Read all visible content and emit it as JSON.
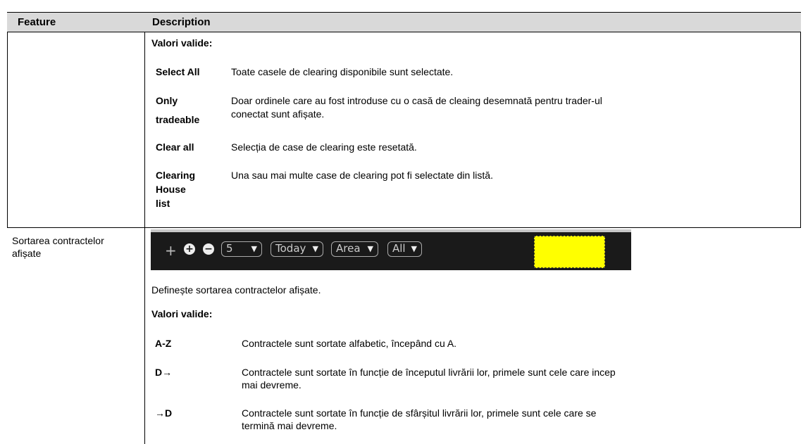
{
  "header": {
    "feature": "Feature",
    "description": "Description"
  },
  "row1": {
    "valori_label": "Valori valide:",
    "items": [
      {
        "key_lines": [
          "Select All"
        ],
        "desc_lines": [
          "Toate casele de clearing disponibile sunt selectate."
        ]
      },
      {
        "key_lines": [
          "Only",
          "tradeable"
        ],
        "desc_lines": [
          "Doar ordinele care au fost introduse cu o casă de cleaing desemnată pentru trader-ul",
          "conectat sunt afișate."
        ]
      },
      {
        "key_lines": [
          "Clear all"
        ],
        "desc_lines": [
          "Selecția de case de clearing este resetată."
        ]
      },
      {
        "key_lines": [
          "Clearing",
          "House",
          "list"
        ],
        "desc_lines": [
          "Una sau mai multe case de clearing pot fi selectate din listă."
        ]
      }
    ]
  },
  "row2": {
    "feature_lines": [
      "Sortarea contractelor",
      "afișate"
    ],
    "toolbar": {
      "plus": "+",
      "zoom_in": "+",
      "zoom_out": "−",
      "count_value": "5",
      "day_value": "Today",
      "area_value": "Area",
      "filter_value": "All",
      "arrow": "▼"
    },
    "intro": "Definește sortarea contractelor afișate.",
    "valori_label": "Valori valide:",
    "items": [
      {
        "key": "A-Z",
        "desc_lines": [
          "Contractele sunt sortate alfabetic, începând cu A."
        ]
      },
      {
        "key": "D→",
        "desc_lines": [
          "Contractele sunt sortate în funcție de începutul livrării lor, primele sunt cele care incep",
          "mai devreme."
        ]
      },
      {
        "key": "→D",
        "desc_lines": [
          "Contractele sunt sortate în funcție de sfârșitul livrării lor, primele sunt cele care se",
          "termină mai devreme."
        ]
      }
    ]
  },
  "colors": {
    "header_bg": "#d9d9d9",
    "toolbar_bg": "#1a1a1a",
    "highlight": "#ffff00"
  }
}
